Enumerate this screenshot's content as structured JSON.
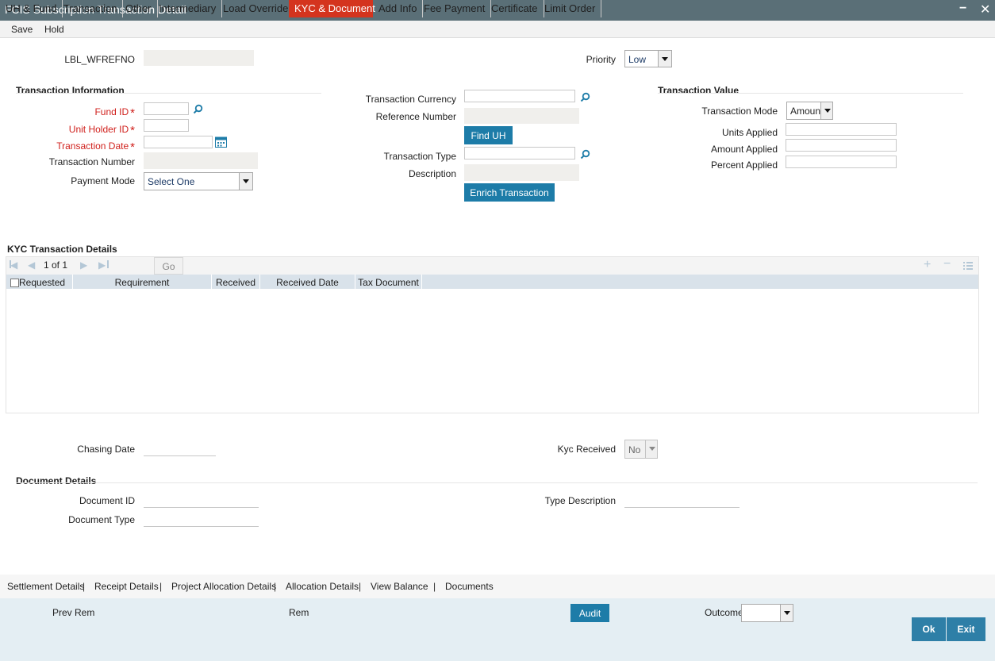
{
  "window": {
    "title": "FCIS Subscription Transaction Detail",
    "minimize": "−",
    "close": "✕"
  },
  "toolbar": {
    "save": "Save",
    "hold": "Hold"
  },
  "header": {
    "wfrefno_label": "LBL_WFREFNO",
    "priority_label": "Priority",
    "priority_value": "Low"
  },
  "txn_info": {
    "title": "Transaction Information",
    "fund_id": "Fund ID",
    "unit_holder_id": "Unit Holder ID",
    "transaction_date": "Transaction Date",
    "transaction_number": "Transaction Number",
    "payment_mode": "Payment Mode",
    "payment_mode_value": "Select One",
    "required_mark": "*"
  },
  "middle": {
    "transaction_currency": "Transaction Currency",
    "reference_number": "Reference Number",
    "find_uh": "Find UH",
    "transaction_type": "Transaction Type",
    "description": "Description",
    "enrich": "Enrich Transaction"
  },
  "txn_value": {
    "title": "Transaction Value",
    "mode_label": "Transaction Mode",
    "mode_value": "Amount",
    "units_applied": "Units Applied",
    "amount_applied": "Amount Applied",
    "percent_applied": "Percent Applied"
  },
  "tabs": [
    "UH & Fund",
    "Transaction",
    "Other",
    "Intermediary",
    "Load Override",
    "KYC & Document",
    "Add Info",
    "Fee Payment",
    "Certificate",
    "Limit Order"
  ],
  "active_tab": "KYC & Document",
  "kyc": {
    "title": "KYC Transaction Details",
    "pager": "1 of 1",
    "go": "Go",
    "columns": [
      "Requested",
      "Requirement",
      "Received",
      "Received Date",
      "Tax Document"
    ]
  },
  "chasing": {
    "chasing_date": "Chasing Date",
    "kyc_received": "Kyc Received",
    "kyc_received_value": "No"
  },
  "documents": {
    "title": "Document Details",
    "document_id": "Document ID",
    "document_type": "Document Type",
    "type_description": "Type Description"
  },
  "links": [
    "Settlement Details",
    "Receipt Details",
    "Project Allocation Details",
    "Allocation Details",
    "View Balance",
    "Documents"
  ],
  "link_separator": "|",
  "footer": {
    "prev_rem": "Prev Rem",
    "rem": "Rem",
    "audit": "Audit",
    "outcome": "Outcome",
    "ok": "Ok",
    "exit": "Exit"
  },
  "colors": {
    "titlebar": "#5a6f77",
    "button": "#1d7ca8",
    "active_tab": "#d4341e",
    "required": "#d0201c",
    "grid_header": "#d9e2ea",
    "footer": "#e4eef3"
  }
}
